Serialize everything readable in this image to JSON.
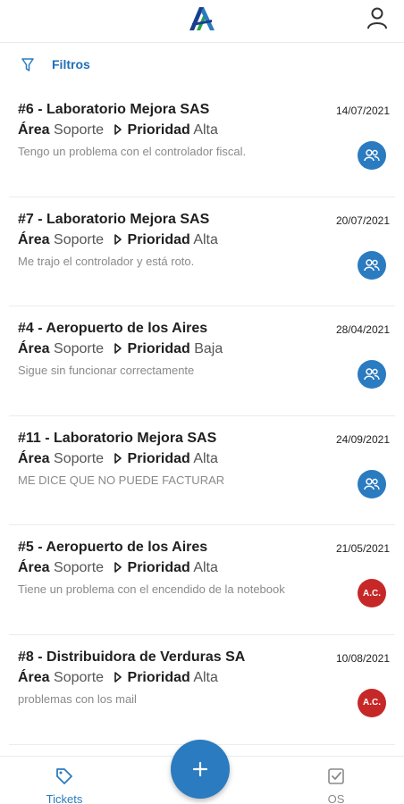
{
  "app": {
    "logo_icon": "brand-logo-icon",
    "profile_icon": "user-profile-icon",
    "accent_color": "#2a7bc0",
    "alert_color": "#c62828"
  },
  "filters": {
    "label": "Filtros",
    "icon": "filter-icon"
  },
  "tickets": [
    {
      "title": "#6 - Laboratorio Mejora SAS",
      "date": "14/07/2021",
      "area_label": "Área",
      "area": "Soporte",
      "priority_label": "Prioridad",
      "priority": "Alta",
      "description": "Tengo un problema con el controlador fiscal.",
      "assignee_type": "group-icon",
      "avatar_color": "#2a7bc0",
      "avatar_text": ""
    },
    {
      "title": "#7 - Laboratorio Mejora SAS",
      "date": "20/07/2021",
      "area_label": "Área",
      "area": "Soporte",
      "priority_label": "Prioridad",
      "priority": "Alta",
      "description": "Me trajo el controlador y está roto.",
      "assignee_type": "group-icon",
      "avatar_color": "#2a7bc0",
      "avatar_text": ""
    },
    {
      "title": "#4 - Aeropuerto de los Aires",
      "date": "28/04/2021",
      "area_label": "Área",
      "area": "Soporte",
      "priority_label": "Prioridad",
      "priority": "Baja",
      "description": "Sigue sin funcionar correctamente",
      "assignee_type": "group-icon",
      "avatar_color": "#2a7bc0",
      "avatar_text": ""
    },
    {
      "title": "#11 - Laboratorio Mejora SAS",
      "date": "24/09/2021",
      "area_label": "Área",
      "area": "Soporte",
      "priority_label": "Prioridad",
      "priority": "Alta",
      "description": "ME DICE QUE NO PUEDE FACTURAR",
      "assignee_type": "group-icon",
      "avatar_color": "#2a7bc0",
      "avatar_text": ""
    },
    {
      "title": "#5 - Aeropuerto de los Aires",
      "date": "21/05/2021",
      "area_label": "Área",
      "area": "Soporte",
      "priority_label": "Prioridad",
      "priority": "Alta",
      "description": "Tiene un problema con el encendido de la notebook",
      "assignee_type": "initials",
      "avatar_color": "#c62828",
      "avatar_text": "A.C."
    },
    {
      "title": "#8 - Distribuidora de Verduras SA",
      "date": "10/08/2021",
      "area_label": "Área",
      "area": "Soporte",
      "priority_label": "Prioridad",
      "priority": "Alta",
      "description": "problemas con los mail",
      "assignee_type": "initials",
      "avatar_color": "#c62828",
      "avatar_text": "A.C."
    }
  ],
  "bottom_nav": {
    "tickets": {
      "label": "Tickets",
      "icon": "tag-icon"
    },
    "fab": {
      "icon": "plus-icon"
    },
    "os": {
      "label": "OS",
      "icon": "checkbox-icon"
    }
  }
}
